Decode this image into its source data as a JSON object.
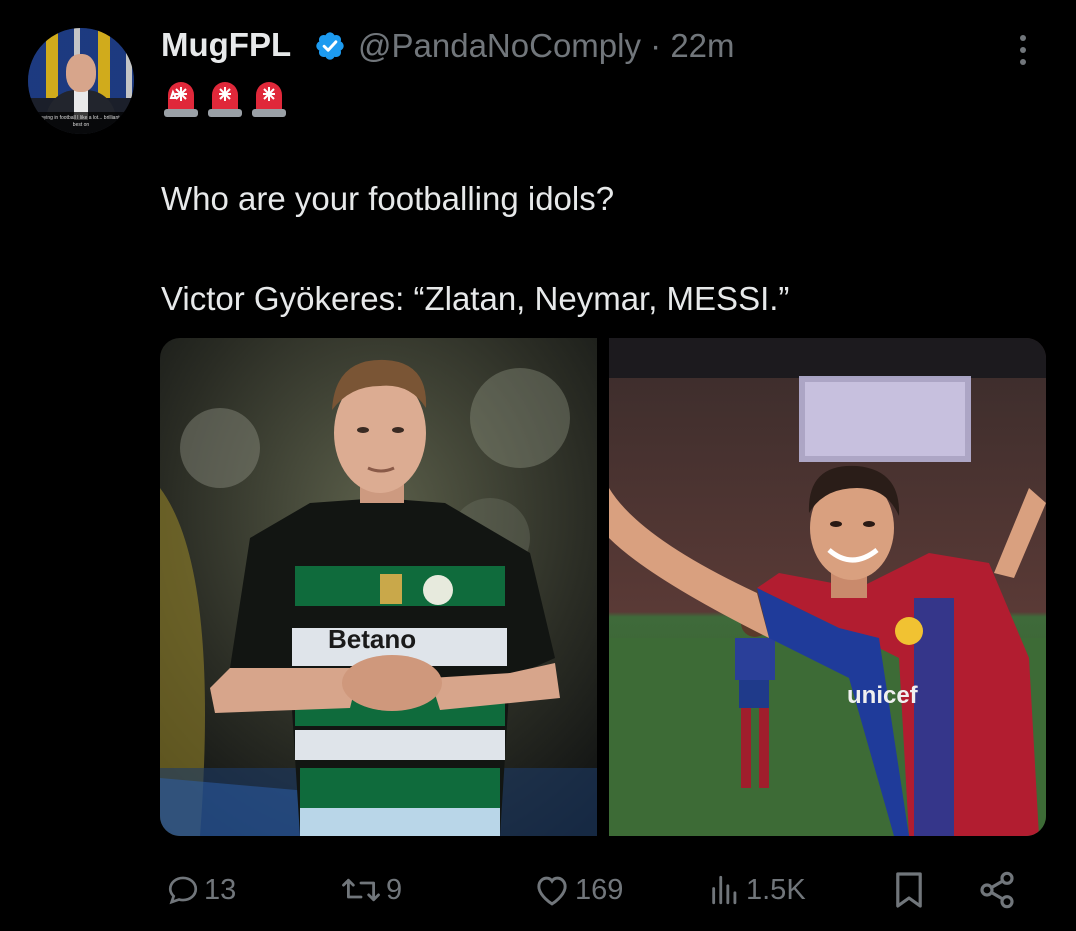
{
  "tweet": {
    "author_name": "MugFPL",
    "handle": "@PandaNoComply",
    "separator": "·",
    "time": "22m",
    "avatar_caption": "re saying in football I like a lot... brilliant, the best on",
    "emoji_line": "🚨🚨🚨",
    "line1": "Who are your footballing idols?",
    "line2": "Victor Gyökeres: “Zlatan, Neymar, MESSI.”",
    "images": [
      {
        "shirt_sponsor": "Betano"
      },
      {
        "shirt_sponsor": "unicef"
      }
    ]
  },
  "actions": {
    "replies": "13",
    "reposts": "9",
    "likes": "169",
    "views": "1.5K"
  },
  "icons": [
    "verified-badge-icon",
    "more-options-icon",
    "siren-icon",
    "reply-icon",
    "repost-icon",
    "like-icon",
    "views-icon",
    "bookmark-icon",
    "share-icon"
  ],
  "colors": {
    "background": "#000000",
    "text": "#e7e9ea",
    "muted": "#71767b",
    "verified": "#1d9bf0"
  }
}
